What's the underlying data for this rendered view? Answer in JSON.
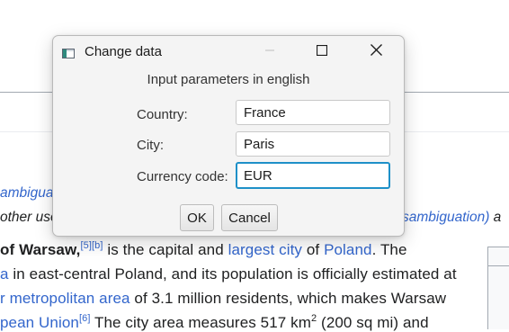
{
  "background_page": {
    "hatnote_line1": {
      "link": "ambiguation"
    },
    "hatnote_line2": {
      "left_text": "other use",
      "right_link": "sambiguation)",
      "right_tail": " a"
    },
    "line1": {
      "bold": "of Warsaw,",
      "sup_refs": "[5][b]",
      "text_a": " is the capital and ",
      "link_a": "largest city",
      "text_b": " of ",
      "link_b": "Poland",
      "text_c": ". The"
    },
    "line2": {
      "link_a": "a",
      "text_a": " in east-central Poland, and its population is officially estimated at"
    },
    "line3": {
      "link_a": "r metropolitan area",
      "text_a": " of 3.1 million residents, which makes Warsaw"
    },
    "line4": {
      "link_a": "pean Union",
      "sup_ref": "[6]",
      "text_a": " The city area measures 517 km",
      "sup_2": "2",
      "text_b": " (200 sq mi) and"
    }
  },
  "dialog": {
    "title": "Change data",
    "app_icon": "java-window-icon",
    "controls": {
      "minimize_icon": "minimize-icon",
      "maximize_icon": "maximize-icon",
      "close_icon": "close-icon"
    },
    "subtitle": "Input parameters in english",
    "fields": {
      "country": {
        "label": "Country:",
        "value": "France"
      },
      "city": {
        "label": "City:",
        "value": "Paris"
      },
      "currency": {
        "label": "Currency code:",
        "value": "EUR"
      }
    },
    "buttons": {
      "ok": "OK",
      "cancel": "Cancel"
    },
    "colors": {
      "focus_border": "#1e90c8",
      "link": "#3366cc",
      "text": "#202122"
    }
  }
}
